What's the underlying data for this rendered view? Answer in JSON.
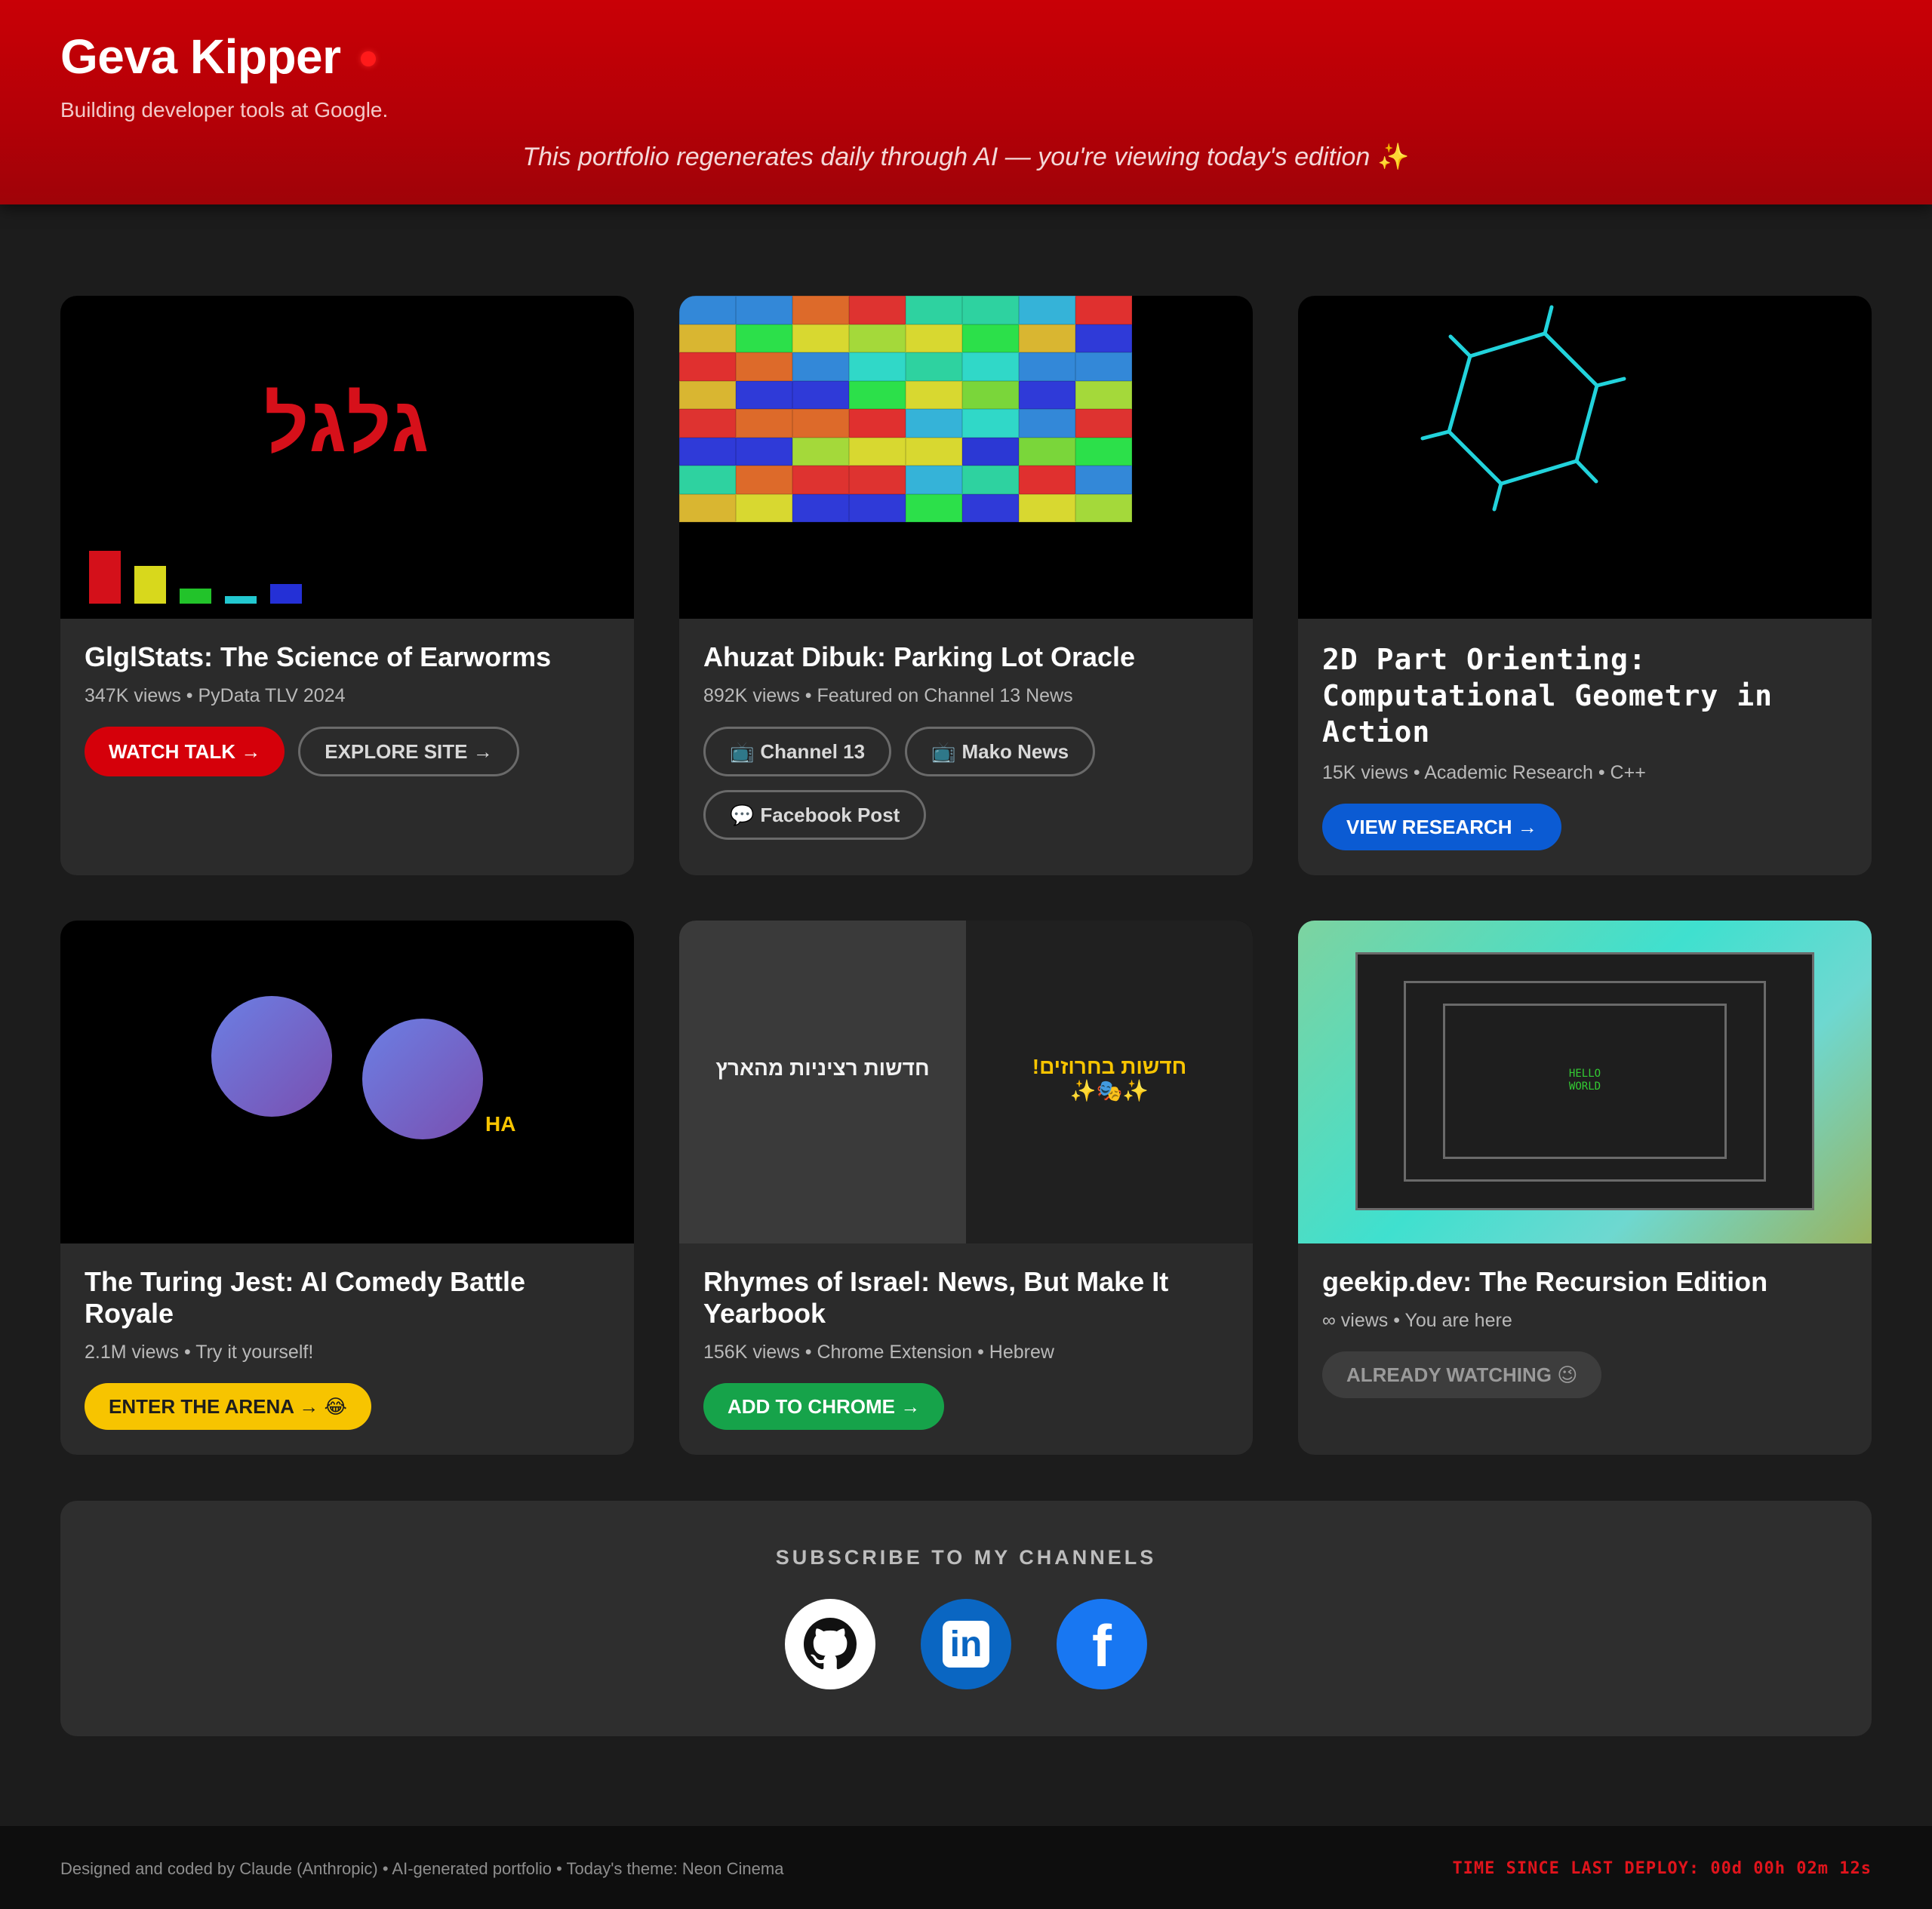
{
  "header": {
    "name": "Geva Kipper",
    "tagline": "Building developer tools at Google.",
    "edition_note": "This portfolio regenerates daily through AI — you're viewing today's edition",
    "edition_emoji": "✨"
  },
  "projects": [
    {
      "title": "GlglStats: The Science of Earworms",
      "meta": "347K views • PyData TLV 2024",
      "thumb_text": "גלגל",
      "buttons": [
        {
          "label": "WATCH TALK →"
        },
        {
          "label": "EXPLORE SITE →"
        }
      ]
    },
    {
      "title": "Ahuzat Dibuk: Parking Lot Oracle",
      "meta": "892K views • Featured on Channel 13 News",
      "buttons": [
        {
          "icon": "📺",
          "label": "Channel 13"
        },
        {
          "icon": "📺",
          "label": "Mako News"
        },
        {
          "icon": "💬",
          "label": "Facebook Post"
        }
      ]
    },
    {
      "title": "2D Part Orienting: Computational Geometry in Action",
      "meta": "15K views • Academic Research • C++",
      "buttons": [
        {
          "label": "VIEW RESEARCH →"
        }
      ]
    },
    {
      "title": "The Turing Jest: AI Comedy Battle Royale",
      "meta": "2.1M views • Try it yourself!",
      "thumb_text": "HA",
      "buttons": [
        {
          "label": "ENTER THE ARENA → 😂"
        }
      ]
    },
    {
      "title": "Rhymes of Israel: News, But Make It Yearbook",
      "meta": "156K views • Chrome Extension • Hebrew",
      "thumb_left": "חדשות רציניות מהארץ",
      "thumb_right_line1": "חדשות בחרוזים!",
      "thumb_right_line2": "✨🎭✨",
      "buttons": [
        {
          "label": "ADD TO CHROME →"
        }
      ]
    },
    {
      "title": "geekip.dev: The Recursion Edition",
      "meta": "∞ views • You are here",
      "thumb_text_1": "HELLO",
      "thumb_text_2": "WORLD",
      "buttons": [
        {
          "label": "ALREADY WATCHING 😉"
        }
      ]
    }
  ],
  "subscribe": {
    "title": "SUBSCRIBE TO MY CHANNELS",
    "channels": [
      {
        "name": "github",
        "icon": "github-icon"
      },
      {
        "name": "linkedin",
        "icon": "linkedin-icon",
        "text": "in"
      },
      {
        "name": "facebook",
        "icon": "facebook-icon",
        "text": "f"
      }
    ]
  },
  "footer": {
    "credits": "Designed and coded by Claude (Anthropic) • AI-generated portfolio • Today's theme: Neon Cinema",
    "deploy_timer": "TIME SINCE LAST DEPLOY: 00d 00h 02m 12s"
  },
  "colors": {
    "accent_red": "#d5000a",
    "research_blue": "#0b5bd3",
    "arena_yellow": "#f7c400",
    "chrome_green": "#16a34a",
    "github": "#ffffff",
    "linkedin": "#0a66c2",
    "facebook": "#1877f2"
  }
}
